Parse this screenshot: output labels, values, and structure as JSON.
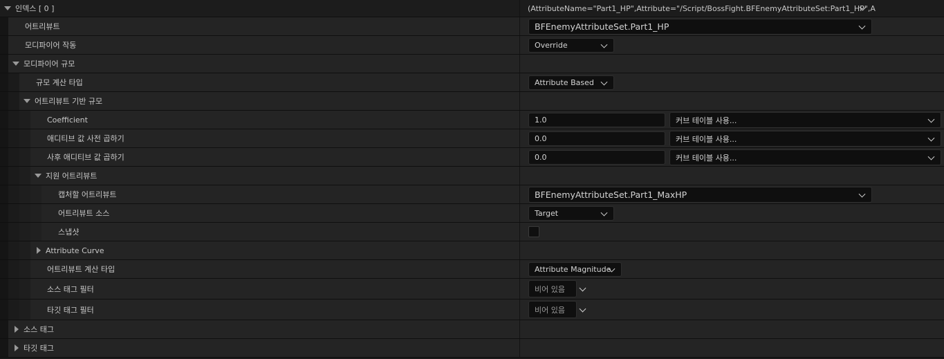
{
  "index_row": {
    "label": "인덱스 [ 0 ]",
    "value": "(AttributeName=\"Part1_HP\",Attribute=\"/Script/BossFight.BFEnemyAttributeSet:Part1_HP\",A"
  },
  "attribute": {
    "label": "어트리뷰트",
    "value": "BFEnemyAttributeSet.Part1_HP"
  },
  "modifier_op": {
    "label": "모디파이어 작동",
    "value": "Override"
  },
  "modifier_magnitude": {
    "label": "모디파이어 규모"
  },
  "magnitude_calc_type": {
    "label": "규모 계산 타입",
    "value": "Attribute Based"
  },
  "attribute_based_magnitude": {
    "label": "어트리뷰트 기반 규모"
  },
  "coefficient": {
    "label": "Coefficient",
    "value": "1.0",
    "curve": "커브 테이블 사용..."
  },
  "pre_multiply": {
    "label": "애디티브 값 사전 곱하기",
    "value": "0.0",
    "curve": "커브 테이블 사용..."
  },
  "post_multiply": {
    "label": "사후 애디티브 값 곱하기",
    "value": "0.0",
    "curve": "커브 테이블 사용..."
  },
  "backing_attribute": {
    "label": "지원 어트리뷰트"
  },
  "capture_attribute": {
    "label": "캡처할 어트리뷰트",
    "value": "BFEnemyAttributeSet.Part1_MaxHP"
  },
  "attribute_source": {
    "label": "어트리뷰트 소스",
    "value": "Target"
  },
  "snapshot": {
    "label": "스냅샷",
    "checked": false
  },
  "attribute_curve": {
    "label": "Attribute Curve"
  },
  "attribute_calc_type": {
    "label": "어트리뷰트 계산 타입",
    "value": "Attribute Magnitude"
  },
  "source_tag_filter": {
    "label": "소스 태그 필터",
    "value": "비어 있음"
  },
  "target_tag_filter": {
    "label": "타깃 태그 필터",
    "value": "비어 있음"
  },
  "source_tags": {
    "label": "소스 태그"
  },
  "target_tags": {
    "label": "타깃 태그"
  }
}
